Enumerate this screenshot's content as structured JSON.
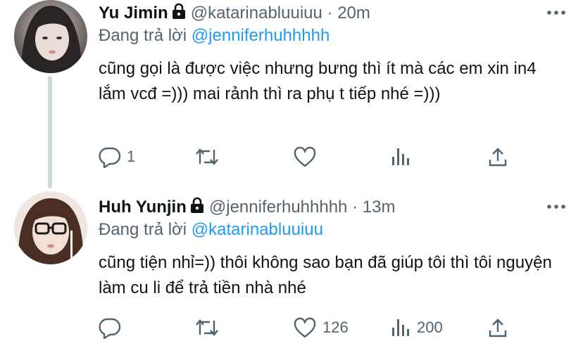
{
  "tweets": [
    {
      "name": "Yu Jimin",
      "handle": "@katarinabluuiuu",
      "dot": "·",
      "time": "20m",
      "replying_prefix": "Đang trả lời",
      "replying_to": "@jenniferhuhhhhh",
      "text": "cũng gọi là được việc nhưng bưng thì ít mà các em xin in4 lắm vcđ =))) mai rảnh thì ra phụ t tiếp nhé =)))",
      "reply_count": "1",
      "retweet_count": "",
      "like_count": "",
      "view_count": ""
    },
    {
      "name": "Huh Yunjin",
      "handle": "@jenniferhuhhhhh",
      "dot": "·",
      "time": "13m",
      "replying_prefix": "Đang trả lời",
      "replying_to": "@katarinabluuiuu",
      "text": "cũng tiện nhỉ=)) thôi không sao bạn đã giúp tôi thì tôi nguyện làm cu li để trả tiền nhà nhé",
      "reply_count": "",
      "retweet_count": "",
      "like_count": "126",
      "view_count": "200"
    }
  ],
  "icons": {
    "lock": "lock-icon",
    "more": "more-icon",
    "reply": "reply-icon",
    "retweet": "retweet-icon",
    "like": "heart-icon",
    "views": "views-icon",
    "share": "share-icon"
  },
  "colors": {
    "text": "#0f1419",
    "muted": "#536471",
    "link": "#1d9bf0",
    "thread_line": "#cfd9de"
  }
}
